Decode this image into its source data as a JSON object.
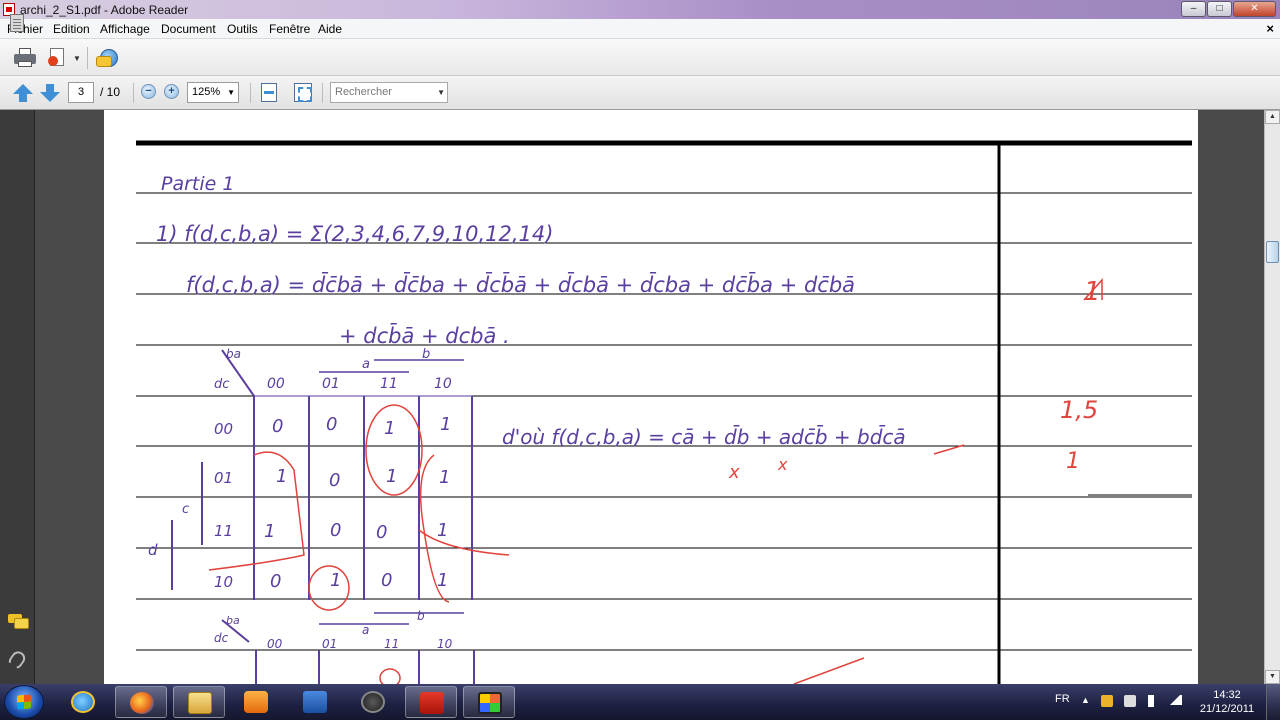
{
  "window": {
    "title": "archi_2_S1.pdf - Adobe Reader",
    "minimize": "–",
    "maximize": "□",
    "close": "✕"
  },
  "menu": {
    "items": [
      "Fichier",
      "Edition",
      "Affichage",
      "Document",
      "Outils",
      "Fenêtre",
      "Aide"
    ],
    "doc_close": "×"
  },
  "nav": {
    "current_page": "3",
    "total_pages": "/ 10",
    "zoom": "125%",
    "search_placeholder": "Rechercher"
  },
  "icons": {
    "print": "printer-icon",
    "export": "export-pdf-icon",
    "share": "collaborate-icon",
    "prev": "arrow-up-icon",
    "next": "arrow-down-icon",
    "zoom_out": "zoom-out-icon",
    "zoom_in": "zoom-in-icon",
    "fit_width": "fit-width-icon",
    "fit_page": "fit-page-icon",
    "pages_panel": "pages-panel-icon",
    "comments": "comments-icon",
    "attachments": "paperclip-icon"
  },
  "zoom_symbols": {
    "out": "−",
    "in": "+"
  },
  "document": {
    "heading": "Partie 1",
    "line1": "1) f(d,c,b,a) = Σ(2,3,4,6,7,9,10,12,14)",
    "line2": "f(d,c,b,a) = d̄c̄bā + d̄c̄ba + d̄cb̄ā + d̄cbā + d̄cba + dc̄b̄a + dc̄bā",
    "line3": "+ dcb̄ā + dcbā .",
    "kmap1": {
      "corner_top": "ba",
      "corner_left": "dc",
      "col_headers": [
        "00",
        "01",
        "11",
        "10"
      ],
      "row_headers": [
        "00",
        "01",
        "11",
        "10"
      ],
      "top_group_a": "a",
      "top_group_b": "b",
      "left_group_c": "c",
      "left_group_d": "d",
      "cells": [
        [
          "0",
          "0",
          "1",
          "1"
        ],
        [
          "1",
          "0",
          "1",
          "1"
        ],
        [
          "1",
          "0",
          "0",
          "1"
        ],
        [
          "0",
          "1",
          "0",
          "1"
        ]
      ]
    },
    "result": "d'où f(d,c,b,a) = cā + d̄b + adc̄b̄ + bd̄cā",
    "kmap2": {
      "corner_top": "ba",
      "corner_left": "dc",
      "col_headers": [
        "00",
        "01",
        "11",
        "10"
      ],
      "top_group_a": "a",
      "top_group_b": "b"
    },
    "margin_marks": [
      "1",
      "1,5",
      "1"
    ],
    "cross_marks": [
      "x",
      "x"
    ],
    "accent_color": "#6a3fa6",
    "correction_color": "#e0443c"
  },
  "taskbar": {
    "apps": [
      "internet-explorer-icon",
      "firefox-icon",
      "file-explorer-icon",
      "media-player-icon",
      "checkmark-app-icon",
      "hp-icon",
      "adobe-reader-icon",
      "video-app-icon"
    ],
    "language": "FR",
    "time": "14:32",
    "date": "21/12/2011"
  }
}
